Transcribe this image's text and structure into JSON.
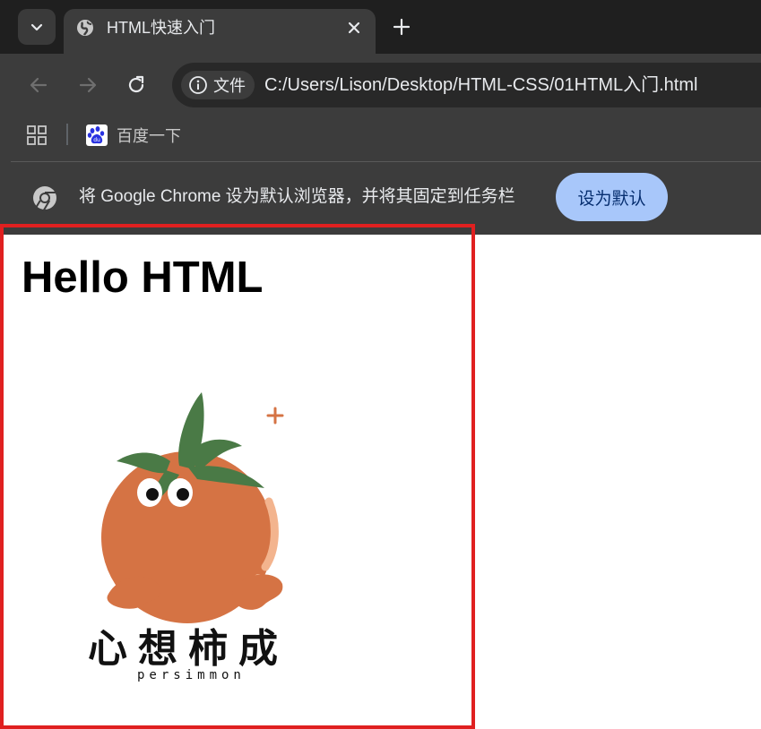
{
  "browser": {
    "tab": {
      "title": "HTML快速入门"
    },
    "omnibox": {
      "security_chip": "文件",
      "url": "C:/Users/Lison/Desktop/HTML-CSS/01HTML入门.html"
    },
    "bookmarks": [
      {
        "label": "百度一下",
        "icon": "baidu-paw-icon"
      }
    ],
    "infobar": {
      "message": "将 Google Chrome 设为默认浏览器，并将其固定到任务栏",
      "button": "设为默认"
    }
  },
  "page": {
    "heading": "Hello HTML",
    "logo": {
      "chinese_text": "心想柿成",
      "english_text": "persimmon",
      "icon": "persimmon-character-icon"
    }
  },
  "colors": {
    "highlight_border": "#e02020",
    "default_button_bg": "#a8c7fa",
    "persimmon_orange": "#d57344",
    "leaf_green": "#4a7a46"
  }
}
